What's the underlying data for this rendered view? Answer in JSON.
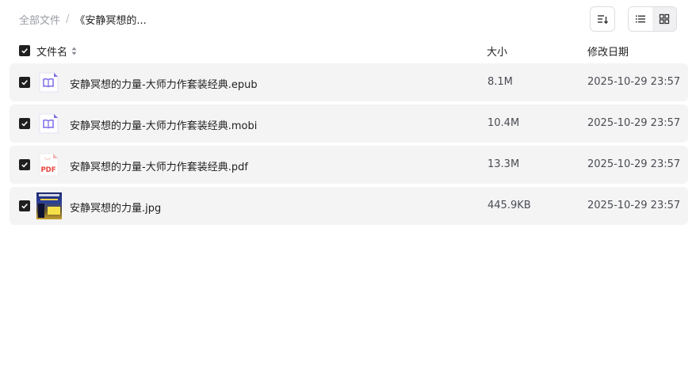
{
  "breadcrumb": {
    "root": "全部文件",
    "separator": "/",
    "current": "《安静冥想的..."
  },
  "toolbar": {
    "sort_icon": "sort-icon",
    "list_view_icon": "list-view-icon",
    "grid_view_icon": "grid-view-icon"
  },
  "table": {
    "header": {
      "name": "文件名",
      "size": "大小",
      "date": "修改日期"
    },
    "rows": [
      {
        "name": "安静冥想的力量-大师力作套装经典.epub",
        "size": "8.1M",
        "date": "2025-10-29 23:57",
        "icon": "book-icon"
      },
      {
        "name": "安静冥想的力量-大师力作套装经典.mobi",
        "size": "10.4M",
        "date": "2025-10-29 23:57",
        "icon": "book-icon"
      },
      {
        "name": "安静冥想的力量-大师力作套装经典.pdf",
        "size": "13.3M",
        "date": "2025-10-29 23:57",
        "icon": "pdf-icon",
        "icon_label": "PDF"
      },
      {
        "name": "安静冥想的力量.jpg",
        "size": "445.9KB",
        "date": "2025-10-29 23:57",
        "icon": "image-thumbnail"
      }
    ]
  },
  "colors": {
    "accent_purple": "#7b6ee8",
    "pdf_red": "#e8453c",
    "row_bg": "#f4f4f5"
  }
}
